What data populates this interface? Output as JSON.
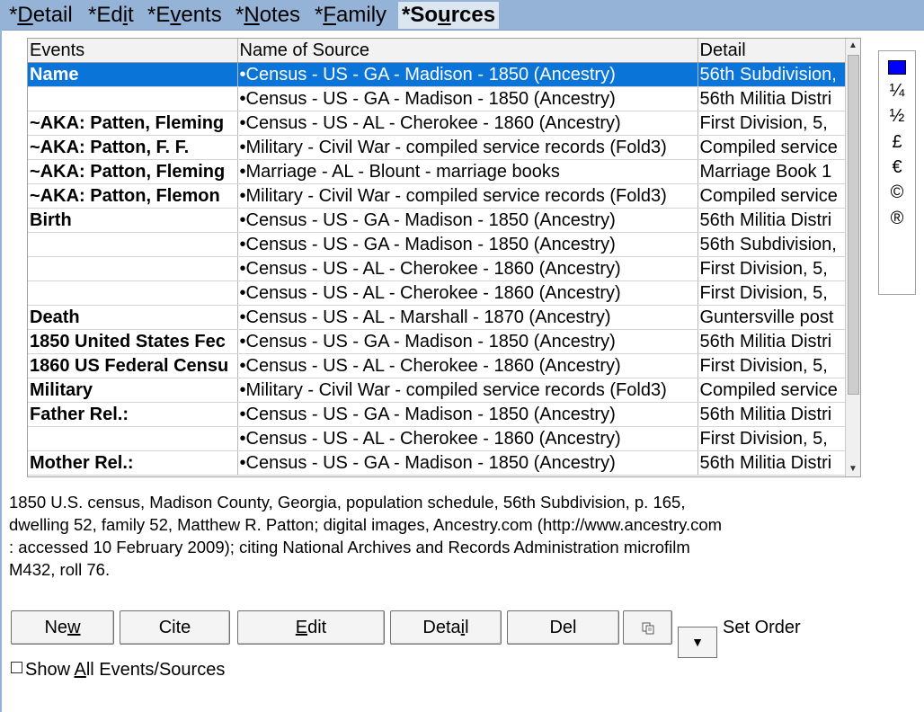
{
  "tabs": [
    {
      "pre": "*",
      "key": "D",
      "rest": "etail"
    },
    {
      "pre": "*Ed",
      "key": "i",
      "rest": "t"
    },
    {
      "pre": "*E",
      "key": "v",
      "rest": "ents"
    },
    {
      "pre": "*",
      "key": "N",
      "rest": "otes"
    },
    {
      "pre": "*",
      "key": "F",
      "rest": "amily"
    },
    {
      "pre": "*So",
      "key": "u",
      "rest": "rces"
    }
  ],
  "grid": {
    "headers": [
      "Events",
      "Name of Source",
      "Detail"
    ],
    "rows": [
      {
        "event": "Name",
        "source": "•Census - US - GA - Madison - 1850 (Ancestry)",
        "detail": "56th Subdivision,"
      },
      {
        "event": "",
        "source": "•Census - US - GA - Madison - 1850 (Ancestry)",
        "detail": "56th Militia Distri"
      },
      {
        "event": "~AKA: Patten, Fleming",
        "source": "•Census - US - AL - Cherokee - 1860 (Ancestry)",
        "detail": "First Division, 5,"
      },
      {
        "event": "~AKA: Patton, F. F.",
        "source": "•Military - Civil War - compiled service records (Fold3)",
        "detail": "Compiled service"
      },
      {
        "event": "~AKA: Patton, Fleming",
        "source": "•Marriage - AL - Blount - marriage books",
        "detail": "Marriage Book 1"
      },
      {
        "event": "~AKA: Patton, Flemon",
        "source": "•Military - Civil War - compiled service records (Fold3)",
        "detail": "Compiled service"
      },
      {
        "event": "Birth",
        "source": "•Census - US - GA - Madison - 1850 (Ancestry)",
        "detail": "56th Militia Distri"
      },
      {
        "event": "",
        "source": "•Census - US - GA - Madison - 1850 (Ancestry)",
        "detail": "56th Subdivision,"
      },
      {
        "event": "",
        "source": "•Census - US - AL - Cherokee - 1860 (Ancestry)",
        "detail": "First Division, 5,"
      },
      {
        "event": "",
        "source": "•Census - US - AL - Cherokee - 1860 (Ancestry)",
        "detail": "First Division, 5,"
      },
      {
        "event": "Death",
        "source": "•Census - US - AL - Marshall - 1870 (Ancestry)",
        "detail": "Guntersville post"
      },
      {
        "event": "1850 United States Fec",
        "source": "•Census - US - GA - Madison - 1850 (Ancestry)",
        "detail": "56th Militia Distri"
      },
      {
        "event": "1860 US Federal Censu",
        "source": "•Census - US - AL - Cherokee - 1860 (Ancestry)",
        "detail": "First Division, 5,"
      },
      {
        "event": "Military",
        "source": "•Military - Civil War - compiled service records (Fold3)",
        "detail": "Compiled service"
      },
      {
        "event": "Father Rel.:",
        "source": "•Census - US - GA - Madison - 1850 (Ancestry)",
        "detail": "56th Militia Distri"
      },
      {
        "event": "",
        "source": "•Census - US - AL - Cherokee - 1860 (Ancestry)",
        "detail": "First Division, 5,"
      },
      {
        "event": "Mother Rel.:",
        "source": "•Census - US - GA - Madison - 1850 (Ancestry)",
        "detail": "56th Militia Distri"
      }
    ],
    "selected_index": 0
  },
  "palette": {
    "swatch_color": "#0000ff",
    "symbols": [
      "¼",
      "½",
      "£",
      "€",
      "©",
      "®"
    ]
  },
  "citation": [
    "1850 U.S. census, Madison County, Georgia, population schedule, 56th Subdivision, p. 165,",
    "dwelling 52, family 52, Matthew R. Patton; digital images, Ancestry.com (http://www.ancestry.com",
    ": accessed 10 February 2009); citing National Archives and Records Administration microfilm",
    "M432, roll 76."
  ],
  "buttons": {
    "new": {
      "pre": "Ne",
      "key": "w",
      "rest": ""
    },
    "cite": {
      "pre": "Cite",
      "key": "",
      "rest": ""
    },
    "edit": {
      "pre": "",
      "key": "E",
      "rest": "dit"
    },
    "detail": {
      "pre": "Deta",
      "key": "i",
      "rest": "l"
    },
    "del": {
      "pre": "Del",
      "key": "",
      "rest": ""
    },
    "copy_icon": "copy-icon",
    "dropdown_icon": "chevron-down-icon"
  },
  "set_order_label": "Set Order",
  "show_all": {
    "pre": "Show ",
    "key": "A",
    "rest": "ll Events/Sources"
  }
}
